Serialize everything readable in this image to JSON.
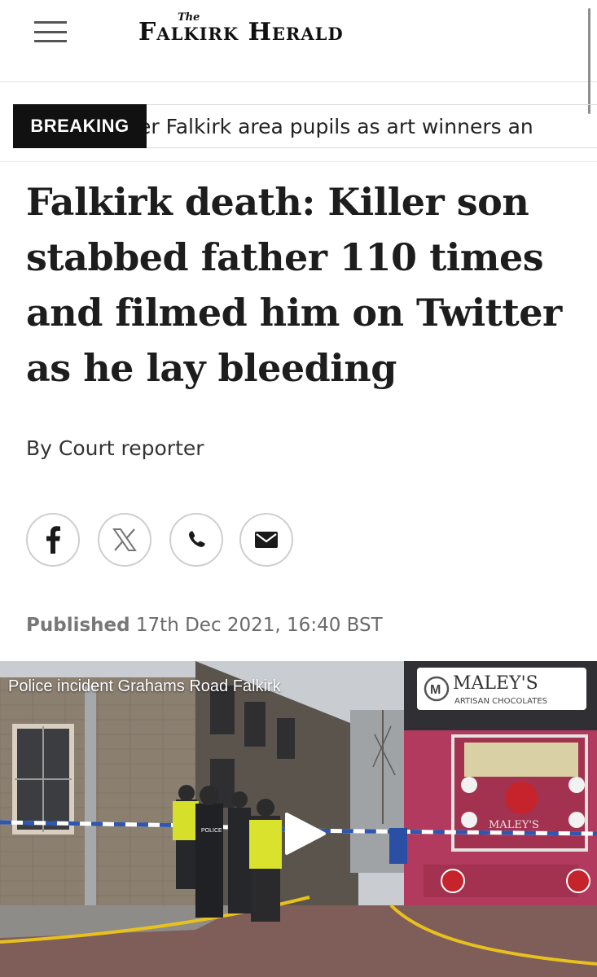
{
  "header": {
    "logo_the": "The",
    "logo_name": "Falkirk Herald",
    "menu_icon": "hamburger-menu-icon"
  },
  "breaking": {
    "label": "BREAKING",
    "ticker_text": "er Falkirk area pupils as art winners an"
  },
  "article": {
    "headline": "Falkirk death: Killer son stabbed father 110 times and filmed him on Twitter as he lay bleeding",
    "byline": "By Court reporter",
    "published_label": "Published",
    "published_date": "17th Dec 2021, 16:40 BST"
  },
  "share": {
    "icons": [
      "facebook-icon",
      "x-twitter-icon",
      "whatsapp-icon",
      "email-icon"
    ]
  },
  "video": {
    "title": "Police incident Grahams Road Falkirk",
    "shop_sign": "MALEY'S",
    "shop_subtitle": "ARTISAN CHOCOLATES",
    "window_sign": "MALEY'S",
    "police_label": "POLICE"
  },
  "colors": {
    "breaking_bg": "#111111",
    "headline": "#1d1d1d",
    "meta_grey": "#6a6a6a",
    "shop_facade": "#b23a5e"
  }
}
